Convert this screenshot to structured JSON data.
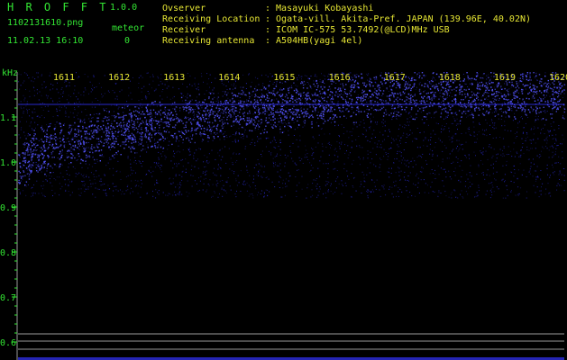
{
  "app": {
    "title": "H R O F F T",
    "version": "1.0.0",
    "filename": "1102131610.png",
    "timestamp": "11.02.13 16:10",
    "meteor_label": "meteor",
    "meteor_count": "0"
  },
  "info": {
    "labels": [
      "Ovserver",
      "Receiving Location",
      "Receiver",
      "Receiving antenna"
    ],
    "values": [
      ": Masayuki Kobayashi",
      ": Ogata-vill. Akita-Pref. JAPAN (139.96E, 40.02N)",
      ": ICOM IC-575 53.7492(@LCD)MHz USB",
      ": A504HB(yagi 4el)"
    ]
  },
  "spectrogram": {
    "unit_label": "kHz",
    "y_ticks": [
      "1.1",
      "1.0",
      "0.9",
      "0.8",
      "0.7",
      "0.6"
    ],
    "y_tick_values": [
      1.1,
      1.0,
      0.9,
      0.8,
      0.7,
      0.6
    ],
    "y_range": [
      0.58,
      1.2
    ],
    "time_labels": [
      "1611",
      "1612",
      "1613",
      "1614",
      "1615",
      "1616",
      "1617",
      "1618",
      "1619",
      "1620"
    ],
    "trace_start_khz": 0.98,
    "trace_end_khz": 1.15,
    "colors": {
      "signal": "#3333ff",
      "text_green": "#33e633",
      "text_yellow": "#e6e633",
      "line_gray": "#9a9a9a"
    }
  }
}
